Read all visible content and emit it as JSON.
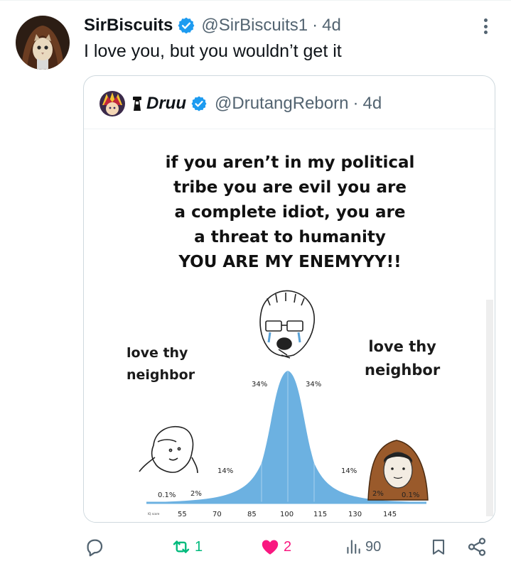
{
  "tweet": {
    "display_name": "SirBiscuits",
    "handle": "@SirBiscuits1",
    "separator": "·",
    "time": "4d",
    "text": "I love you, but you wouldn’t get it"
  },
  "quoted_tweet": {
    "display_name": "Druu",
    "handle": "@DrutangReborn",
    "separator": "·",
    "time": "4d",
    "media": {
      "top_text": [
        "if you aren’t in my political",
        "tribe you are evil you are",
        "a complete idiot, you are",
        "a threat to humanity",
        "YOU ARE MY ENEMYYY!!"
      ],
      "left_label": [
        "love thy",
        "neighbor"
      ],
      "right_label": [
        "love thy",
        "neighbor"
      ],
      "iq_label": "IQ score",
      "percent_labels": [
        "0.1%",
        "2%",
        "14%",
        "34%",
        "34%",
        "14%",
        "2%",
        "0.1%"
      ],
      "x_ticks": [
        "55",
        "70",
        "85",
        "100",
        "115",
        "130",
        "145"
      ]
    }
  },
  "actions": {
    "retweets": "1",
    "likes": "2",
    "views": "90"
  },
  "colors": {
    "verified": "#1d9bf0",
    "retweet": "#00ba7c",
    "like": "#f91880",
    "muted": "#536471",
    "curve": "#6cb1e1"
  }
}
